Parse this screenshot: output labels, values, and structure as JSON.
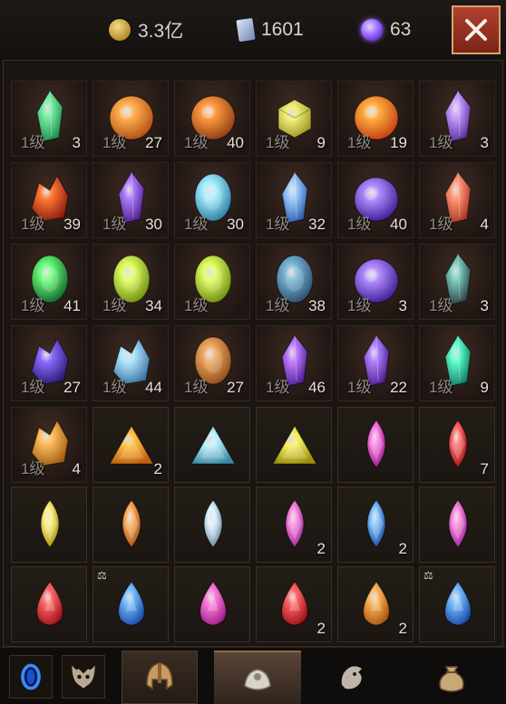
{
  "currency": {
    "gold": {
      "icon": "gold-coin-icon",
      "value": "3.3亿"
    },
    "cards": {
      "icon": "card-icon",
      "value": "1601"
    },
    "orbs": {
      "icon": "purple-orb-icon",
      "value": "63"
    }
  },
  "close_icon": "close-icon",
  "level_label": "1级",
  "inventory": [
    {
      "kind": "mat",
      "art": "green-crystal",
      "level": true,
      "count": "3"
    },
    {
      "kind": "mat",
      "art": "orange-orb",
      "level": true,
      "count": "27"
    },
    {
      "kind": "mat",
      "art": "orange-shell",
      "level": true,
      "count": "40"
    },
    {
      "kind": "mat",
      "art": "yellow-cube",
      "level": true,
      "count": "9"
    },
    {
      "kind": "mat",
      "art": "magma-orb",
      "level": true,
      "count": "19"
    },
    {
      "kind": "mat",
      "art": "purple-crystal",
      "level": true,
      "count": "3"
    },
    {
      "kind": "mat",
      "art": "fire-swirl",
      "level": true,
      "count": "39"
    },
    {
      "kind": "mat",
      "art": "purple-shard",
      "level": true,
      "count": "30"
    },
    {
      "kind": "mat",
      "art": "cyan-egg",
      "level": true,
      "count": "30"
    },
    {
      "kind": "mat",
      "art": "blue-crystal",
      "level": true,
      "count": "32"
    },
    {
      "kind": "mat",
      "art": "violet-orb",
      "level": true,
      "count": "40"
    },
    {
      "kind": "mat",
      "art": "red-crystal",
      "level": true,
      "count": "4"
    },
    {
      "kind": "mat",
      "art": "emerald-eye",
      "level": true,
      "count": "41"
    },
    {
      "kind": "mat",
      "art": "lime-egg",
      "level": true,
      "count": "34"
    },
    {
      "kind": "mat",
      "art": "lime-egg",
      "level": true,
      "count": ""
    },
    {
      "kind": "mat",
      "art": "runed-stone",
      "level": true,
      "count": "38"
    },
    {
      "kind": "mat",
      "art": "violet-orb",
      "level": true,
      "count": "3"
    },
    {
      "kind": "mat",
      "art": "dark-crystal",
      "level": true,
      "count": "3"
    },
    {
      "kind": "mat",
      "art": "amethyst-cluster",
      "level": true,
      "count": "27"
    },
    {
      "kind": "mat",
      "art": "ice-cluster",
      "level": true,
      "count": "44"
    },
    {
      "kind": "mat",
      "art": "amber-stone",
      "level": true,
      "count": "27"
    },
    {
      "kind": "mat",
      "art": "purple-flame",
      "level": true,
      "count": "46"
    },
    {
      "kind": "mat",
      "art": "purple-shard",
      "level": true,
      "count": "22"
    },
    {
      "kind": "mat",
      "art": "teal-crystal",
      "level": true,
      "count": "9"
    },
    {
      "kind": "mat",
      "art": "amber-cluster",
      "level": true,
      "count": "4"
    },
    {
      "kind": "gem",
      "art": "tri-orange",
      "level": false,
      "count": "2"
    },
    {
      "kind": "gem",
      "art": "tri-cyan",
      "level": false,
      "count": ""
    },
    {
      "kind": "gem",
      "art": "tri-yellow",
      "level": false,
      "count": ""
    },
    {
      "kind": "gem",
      "art": "marquise-magenta",
      "level": false,
      "count": ""
    },
    {
      "kind": "gem",
      "art": "marquise-red",
      "level": false,
      "count": "7"
    },
    {
      "kind": "gem",
      "art": "marquise-yellow",
      "level": false,
      "count": ""
    },
    {
      "kind": "gem",
      "art": "marquise-orange",
      "level": false,
      "count": ""
    },
    {
      "kind": "gem",
      "art": "marquise-silver",
      "level": false,
      "count": ""
    },
    {
      "kind": "gem",
      "art": "marquise-pink",
      "level": false,
      "count": "2"
    },
    {
      "kind": "gem",
      "art": "marquise-blue",
      "level": false,
      "count": "2"
    },
    {
      "kind": "gem",
      "art": "marquise-pink",
      "level": false,
      "count": ""
    },
    {
      "kind": "gem",
      "art": "drop-red",
      "level": false,
      "count": "",
      "scale": false
    },
    {
      "kind": "gem",
      "art": "drop-blue",
      "level": false,
      "count": "",
      "scale": true
    },
    {
      "kind": "gem",
      "art": "drop-magenta",
      "level": false,
      "count": "",
      "scale": false
    },
    {
      "kind": "gem",
      "art": "drop-red",
      "level": false,
      "count": "2",
      "scale": false
    },
    {
      "kind": "gem",
      "art": "drop-orange",
      "level": false,
      "count": "2",
      "scale": false
    },
    {
      "kind": "gem",
      "art": "drop-blue",
      "level": false,
      "count": "",
      "scale": true
    }
  ],
  "colors": {
    "green-crystal": [
      "#7cf0a8",
      "#1b8a4c"
    ],
    "orange-orb": [
      "#ffb050",
      "#b04a10"
    ],
    "orange-shell": [
      "#ff9a40",
      "#8a3a12"
    ],
    "yellow-cube": [
      "#f2f07a",
      "#9a9420"
    ],
    "magma-orb": [
      "#ffb040",
      "#c23a10"
    ],
    "purple-crystal": [
      "#c9a0ff",
      "#5a2a9a"
    ],
    "fire-swirl": [
      "#ff7a30",
      "#8a1a10"
    ],
    "purple-shard": [
      "#b080ff",
      "#4a1a8a"
    ],
    "cyan-egg": [
      "#a8f0ff",
      "#2a7aa0"
    ],
    "blue-crystal": [
      "#a0d0ff",
      "#2a5aa8"
    ],
    "violet-orb": [
      "#b28cff",
      "#3a1890"
    ],
    "red-crystal": [
      "#ff9a7a",
      "#a83020"
    ],
    "emerald-eye": [
      "#6aff7a",
      "#10602a"
    ],
    "lime-egg": [
      "#e0ff60",
      "#6a8a10"
    ],
    "runed-stone": [
      "#7ab8d8",
      "#2a4a6a"
    ],
    "dark-crystal": [
      "#80d0c0",
      "#283a40"
    ],
    "amethyst-cluster": [
      "#8a6aff",
      "#2a1a70"
    ],
    "ice-cluster": [
      "#b0e8ff",
      "#3a70a0"
    ],
    "amber-stone": [
      "#f0a860",
      "#8a4a18"
    ],
    "purple-flame": [
      "#c080ff",
      "#4a1a90"
    ],
    "teal-crystal": [
      "#60ffd0",
      "#107a60"
    ],
    "amber-cluster": [
      "#ffc060",
      "#a05a10"
    ],
    "tri-orange": [
      "#ffc040",
      "#c06010"
    ],
    "tri-cyan": [
      "#bff4ff",
      "#3a8aa8"
    ],
    "tri-yellow": [
      "#f8f060",
      "#9a9010"
    ],
    "marquise-magenta": [
      "#ff80e8",
      "#9a1a8a"
    ],
    "marquise-red": [
      "#ff7070",
      "#a01010"
    ],
    "marquise-yellow": [
      "#fff080",
      "#a89010"
    ],
    "marquise-orange": [
      "#ffb060",
      "#a85010"
    ],
    "marquise-silver": [
      "#e0f4ff",
      "#6a8aa0"
    ],
    "marquise-pink": [
      "#ff8ae0",
      "#9a2a9a"
    ],
    "marquise-blue": [
      "#80c8ff",
      "#1a4aa0"
    ],
    "drop-red": [
      "#ff6a6a",
      "#a01018"
    ],
    "drop-blue": [
      "#7ac0ff",
      "#1a4aa8"
    ],
    "drop-magenta": [
      "#ff80e0",
      "#a0208a"
    ],
    "drop-orange": [
      "#ffb860",
      "#a85410"
    ]
  },
  "bottom": {
    "left_buttons": [
      "blue-portal-icon",
      "demon-mask-icon"
    ],
    "tabs": [
      {
        "icon": "helmet-icon",
        "active": false,
        "highlight": true
      },
      {
        "icon": "gem-pouch-icon",
        "active": true
      },
      {
        "icon": "dragon-emblem-icon",
        "active": false
      },
      {
        "icon": "loot-bag-icon",
        "active": false
      }
    ]
  }
}
